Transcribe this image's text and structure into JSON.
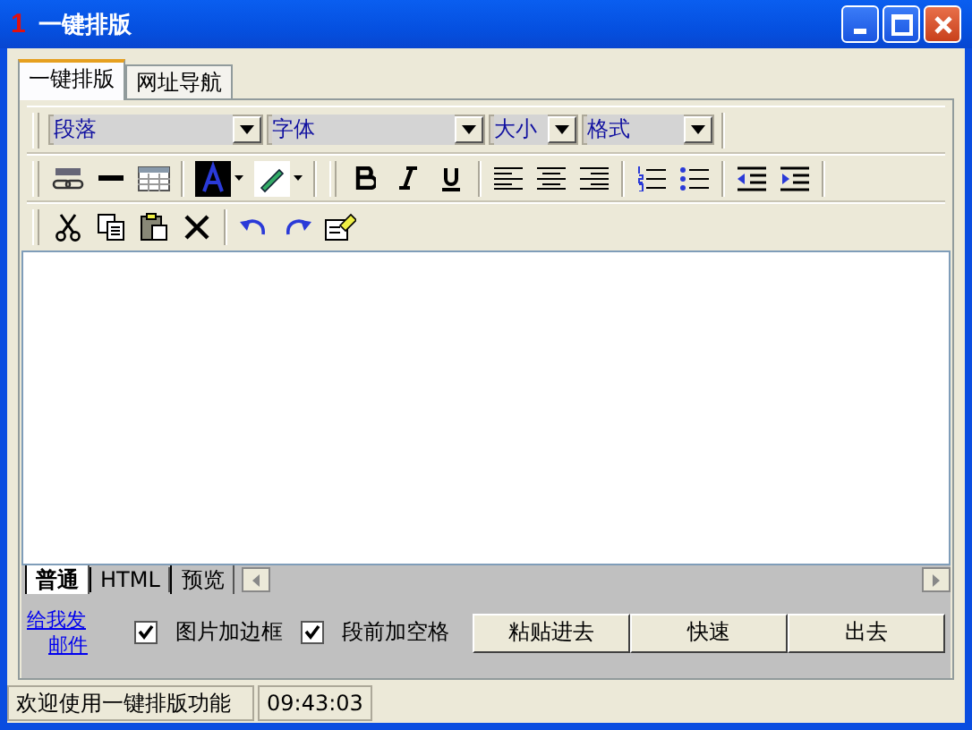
{
  "window": {
    "title": "一键排版",
    "title_number": "1"
  },
  "tabs": [
    {
      "label": "一键排版",
      "selected": true
    },
    {
      "label": "网址导航",
      "selected": false
    }
  ],
  "format_dropdowns": [
    {
      "value": "段落"
    },
    {
      "value": "字体"
    },
    {
      "value": "大小"
    },
    {
      "value": "格式"
    }
  ],
  "editor_tabs": [
    {
      "label": "普通",
      "selected": true
    },
    {
      "label": "HTML",
      "selected": false
    },
    {
      "label": "预览",
      "selected": false
    }
  ],
  "email_link": {
    "line_1": "给我发",
    "line_2": "邮件"
  },
  "options": [
    {
      "label": "图片加边框",
      "checked": true
    },
    {
      "label": "段前加空格",
      "checked": true
    }
  ],
  "buttons": [
    "粘贴进去",
    "快速",
    "出去"
  ],
  "status_bar": {
    "message": "欢迎使用一键排版功能",
    "time": "09:43:03"
  }
}
